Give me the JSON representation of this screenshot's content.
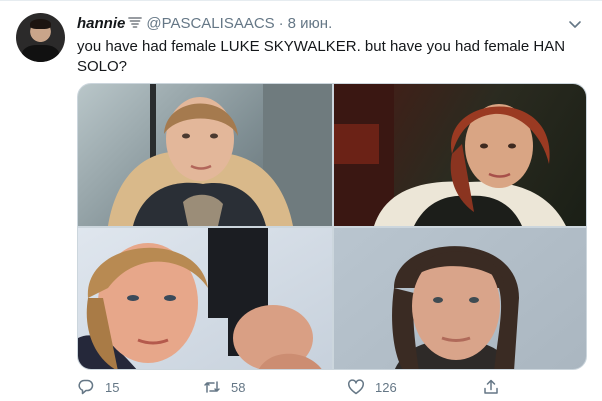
{
  "tweet": {
    "display_name": "hannie",
    "handle": "@PASCALISAACS",
    "separator": "·",
    "date": "8 июн.",
    "text": "you have had female LUKE SKYWALKER. but have you had female HAN SOLO?",
    "media_count": 4
  },
  "actions": {
    "reply_count": "15",
    "retweet_count": "58",
    "like_count": "126"
  },
  "icons": {
    "header_glyph": "tornado-icon",
    "menu": "chevron-down-icon",
    "reply": "reply-icon",
    "retweet": "retweet-icon",
    "like": "heart-icon",
    "share": "share-icon"
  },
  "colors": {
    "text": "#14171a",
    "secondary": "#657786",
    "border": "#e6ecf0"
  }
}
